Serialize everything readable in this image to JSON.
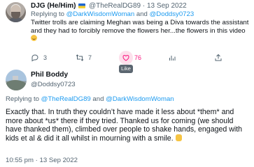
{
  "reply_tweet": {
    "display_name": "DJG (He/Him)",
    "handle": "@TheRealDG89",
    "separator": "·",
    "date": "13 Sep 2022",
    "replying_prefix": "Replying to",
    "replying_to_1": "@DarkWisdomWoman",
    "replying_and": "and",
    "replying_to_2": "@Doddsy0723",
    "text": "Twitter trolls are claiming Meghan was being a Diva towards the assistant and they had to forcibly remove the flowers her...the flowers in this video",
    "actions": {
      "reply_count": "3",
      "retweet_count": "7",
      "like_count": "76"
    },
    "like_tooltip": "Like",
    "colors": {
      "like": "#f91880",
      "link": "#1d9bf0",
      "muted": "#536471"
    },
    "icons": [
      "reply-icon",
      "retweet-icon",
      "like-icon",
      "views-icon",
      "share-icon"
    ]
  },
  "main_tweet": {
    "display_name": "Phil Boddy",
    "handle": "@Doddsy0723",
    "replying_prefix": "Replying to",
    "replying_to_1": "@TheRealDG89",
    "replying_and": "and",
    "replying_to_2": "@DarkWisdomWoman",
    "text": "Exactly that. In truth they couldn’t have made it less about *them* and more about *us* there if they tried. Thanked us for coming (we should have thanked them), climbed over people to shake hands, engaged with kids et al & did it all whilst in mourning with a smile.",
    "timestamp": "10:55 pm · 13 Sep 2022"
  }
}
